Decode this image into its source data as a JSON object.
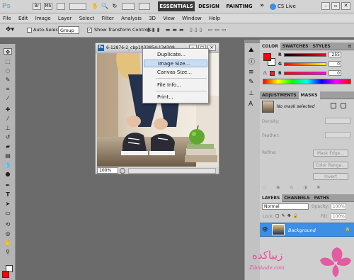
{
  "app": {
    "logo": "Ps"
  },
  "topbar": {
    "workspace_buttons": [
      "ESSENTIALS",
      "DESIGN",
      "PAINTING"
    ],
    "more_label": "»",
    "cslive_label": "CS Live"
  },
  "menu": {
    "items": [
      "File",
      "Edit",
      "Image",
      "Layer",
      "Select",
      "Filter",
      "Analysis",
      "3D",
      "View",
      "Window",
      "Help"
    ]
  },
  "options": {
    "auto_select_label": "Auto-Select:",
    "auto_select_value": "Group",
    "show_transform_label": "Show Transform Controls"
  },
  "document": {
    "title": "6-12876-2_cbp1033854-134308...",
    "zoom": "100%"
  },
  "context_menu": {
    "items": [
      "Duplicate...",
      "Image Size...",
      "Canvas Size...",
      "File Info...",
      "Print..."
    ],
    "highlighted_index": 1
  },
  "color_panel": {
    "tabs": [
      "COLOR",
      "SWATCHES",
      "STYLES"
    ],
    "channels": [
      {
        "label": "R",
        "value": "255"
      },
      {
        "label": "G",
        "value": "0"
      },
      {
        "label": "B",
        "value": "0"
      }
    ],
    "foreground_color": "#ff0000",
    "background_color": "#ffffff"
  },
  "masks_panel": {
    "tabs": [
      "ADJUSTMENTS",
      "MASKS"
    ],
    "status": "No mask selected",
    "density_label": "Density:",
    "feather_label": "Feather:",
    "refine_label": "Refine:",
    "buttons": [
      "Mask Edge...",
      "Color Range...",
      "Invert"
    ]
  },
  "layers_panel": {
    "tabs": [
      "LAYERS",
      "CHANNELS",
      "PATHS"
    ],
    "blend_mode": "Normal",
    "opacity_label": "Opacity:",
    "opacity_value": "100%",
    "lock_label": "Lock:",
    "fill_label": "Fill:",
    "fill_value": "100%",
    "layer_name": "Background"
  },
  "watermark": {
    "text": "زیباکده",
    "subtext": "Zibakade.com"
  },
  "colors": {
    "accent_blue": "#3d8ee6",
    "workspace_gray": "#6b6b6b",
    "foreground": "#ff0000"
  }
}
